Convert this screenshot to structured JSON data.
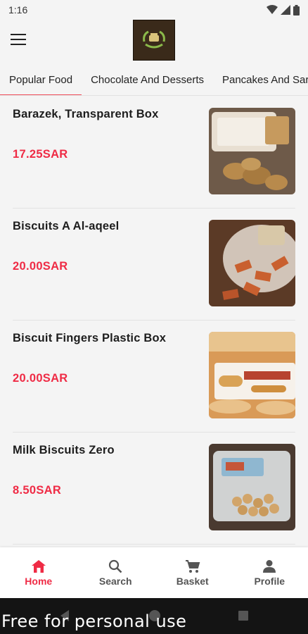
{
  "status": {
    "time": "1:16"
  },
  "tabs": [
    {
      "label": "Popular Food",
      "active": true
    },
    {
      "label": "Chocolate And Desserts",
      "active": false
    },
    {
      "label": "Pancakes And Sar",
      "active": false
    }
  ],
  "products": [
    {
      "name": "Barazek, Transparent Box",
      "price": "17.25SAR"
    },
    {
      "name": "Biscuits A Al-aqeel",
      "price": "20.00SAR"
    },
    {
      "name": "Biscuit Fingers Plastic Box",
      "price": "20.00SAR"
    },
    {
      "name": "Milk Biscuits Zero",
      "price": "8.50SAR"
    }
  ],
  "bottom_nav": [
    {
      "label": "Home",
      "icon": "home-icon",
      "active": true
    },
    {
      "label": "Search",
      "icon": "search-icon",
      "active": false
    },
    {
      "label": "Basket",
      "icon": "cart-icon",
      "active": false
    },
    {
      "label": "Profile",
      "icon": "person-icon",
      "active": false
    }
  ],
  "watermark": "Free for personal use",
  "colors": {
    "accent": "#ef2b45",
    "tab_indicator": "#ef4f5b"
  }
}
